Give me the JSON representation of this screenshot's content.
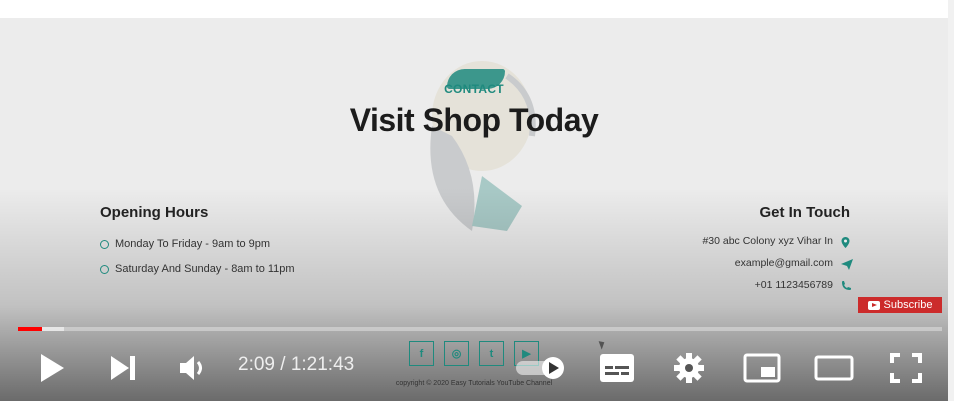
{
  "page": {
    "contact_label": "CONTACT",
    "title": "Visit Shop Today"
  },
  "opening_hours": {
    "title": "Opening Hours",
    "lines": [
      "Monday To Friday - 9am to 9pm",
      "Saturday And Sunday - 8am to 11pm"
    ]
  },
  "get_in_touch": {
    "title": "Get In Touch",
    "address": "#30 abc Colony xyz Vihar In",
    "email": "example@gmail.com",
    "phone": "+01 1123456789"
  },
  "subscribe": {
    "label": "Subscribe"
  },
  "footer": {
    "social": [
      "f",
      "◎",
      "t",
      "▶"
    ],
    "copyright": "copyright © 2020 Easy Tutorials YouTube Channel"
  },
  "player": {
    "time": "2:09 / 1:21:43",
    "progress_played_fraction": 0.026,
    "progress_loaded_fraction": 0.05,
    "icons": [
      "play-icon",
      "next-icon",
      "volume-icon",
      "autoplay-toggle-icon",
      "subtitles-icon",
      "settings-icon",
      "miniplayer-icon",
      "theater-mode-icon",
      "fullscreen-icon"
    ]
  },
  "colors": {
    "accent": "#1f8a7e",
    "progress": "#ff0000",
    "subscribe": "#cc2b2b"
  }
}
